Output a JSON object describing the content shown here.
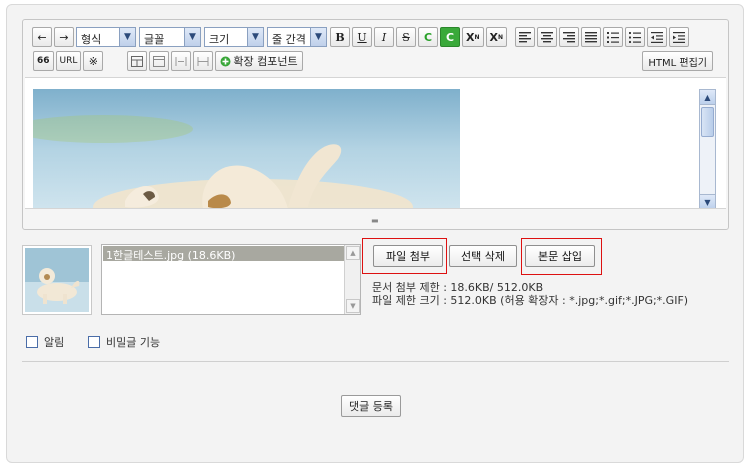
{
  "toolbar": {
    "undo_label": "←",
    "redo_label": "→",
    "format_select": "형식",
    "font_select": "글꼴",
    "size_select": "크기",
    "line_height_select": "줄 간격",
    "bold": "B",
    "underline": "U",
    "italic": "I",
    "strike": "S",
    "font_color": "C",
    "bg_color": "C",
    "superscript": "X",
    "subscript": "X",
    "superscript_mark": "N",
    "subscript_mark": "N",
    "quote": "66",
    "url": "URL",
    "special_char": "※",
    "extension_component": "확장 컴포넌트",
    "html_edit": "HTML 편집기"
  },
  "attachments": {
    "files": [
      "1한글테스트.jpg (18.6KB)"
    ],
    "attach_button": "파일 첨부",
    "delete_button": "선택 삭제",
    "insert_button": "본문 삽입",
    "doc_limit": "문서 첨부 제한 : 18.6KB/ 512.0KB",
    "file_limit": "파일 제한 크기 : 512.0KB (허용 확장자 : *.jpg;*.gif;*.JPG;*.GIF)"
  },
  "options": {
    "notify": "알림",
    "secret": "비밀글 기능"
  },
  "submit_label": "댓글 등록",
  "colors": {
    "highlight": "#dd1111",
    "font_color_green": "#2aa12a",
    "bg_color_green": "#3aa93a"
  }
}
